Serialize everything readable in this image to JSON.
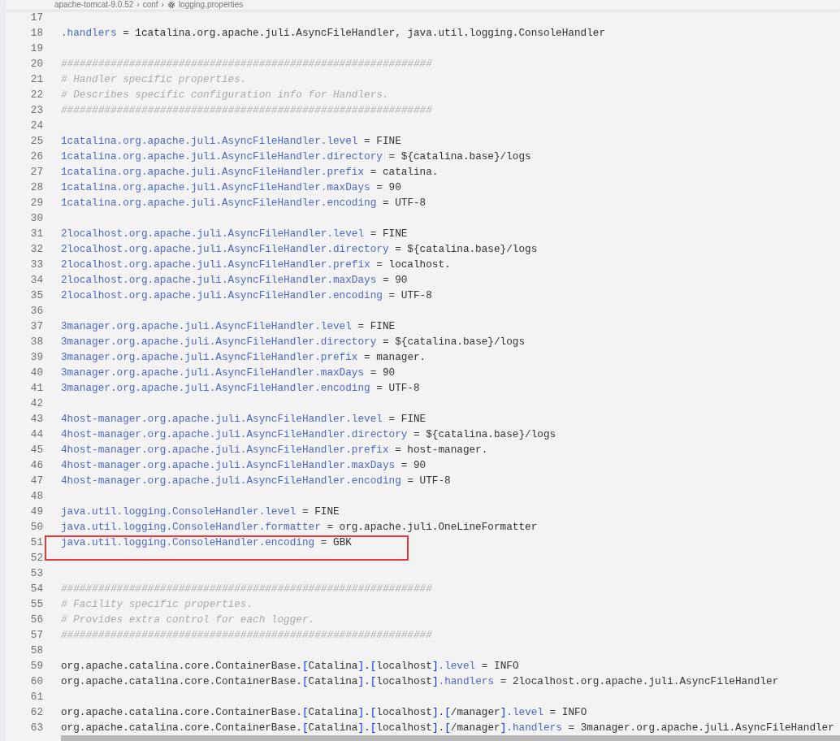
{
  "breadcrumb_separator": "›",
  "breadcrumb": [
    {
      "label": "apache-tomcat-9.0.52",
      "kind": "folder"
    },
    {
      "label": "conf",
      "kind": "folder"
    },
    {
      "label": "logging.properties",
      "kind": "file"
    }
  ],
  "lines": [
    {
      "number": "17",
      "boxed": false
    },
    {
      "number": "18",
      "boxed": false,
      "tokens": [
        {
          "kind": "key",
          "text": ".handlers"
        },
        {
          "kind": "value",
          "text": " = 1catalina.org.apache.juli.AsyncFileHandler, java.util.logging.ConsoleHandler"
        }
      ]
    },
    {
      "number": "19",
      "boxed": false
    },
    {
      "number": "20",
      "boxed": false,
      "tokens": [
        {
          "kind": "comment",
          "text": "############################################################"
        }
      ]
    },
    {
      "number": "21",
      "boxed": false,
      "tokens": [
        {
          "kind": "comment",
          "text": "# Handler specific properties."
        }
      ]
    },
    {
      "number": "22",
      "boxed": false,
      "tokens": [
        {
          "kind": "comment",
          "text": "# Describes specific configuration info for Handlers."
        }
      ]
    },
    {
      "number": "23",
      "boxed": false,
      "tokens": [
        {
          "kind": "comment",
          "text": "############################################################"
        }
      ]
    },
    {
      "number": "24",
      "boxed": false
    },
    {
      "number": "25",
      "boxed": false,
      "tokens": [
        {
          "kind": "key",
          "text": "1catalina.org.apache.juli.AsyncFileHandler.level"
        },
        {
          "kind": "value",
          "text": " = FINE"
        }
      ]
    },
    {
      "number": "26",
      "boxed": false,
      "tokens": [
        {
          "kind": "key",
          "text": "1catalina.org.apache.juli.AsyncFileHandler.directory"
        },
        {
          "kind": "value",
          "text": " = ${catalina.base}/logs"
        }
      ]
    },
    {
      "number": "27",
      "boxed": false,
      "tokens": [
        {
          "kind": "key",
          "text": "1catalina.org.apache.juli.AsyncFileHandler.prefix"
        },
        {
          "kind": "value",
          "text": " = catalina."
        }
      ]
    },
    {
      "number": "28",
      "boxed": false,
      "tokens": [
        {
          "kind": "key",
          "text": "1catalina.org.apache.juli.AsyncFileHandler.maxDays"
        },
        {
          "kind": "value",
          "text": " = 90"
        }
      ]
    },
    {
      "number": "29",
      "boxed": false,
      "tokens": [
        {
          "kind": "key",
          "text": "1catalina.org.apache.juli.AsyncFileHandler.encoding"
        },
        {
          "kind": "value",
          "text": " = UTF-8"
        }
      ]
    },
    {
      "number": "30",
      "boxed": false
    },
    {
      "number": "31",
      "boxed": false,
      "tokens": [
        {
          "kind": "key",
          "text": "2localhost.org.apache.juli.AsyncFileHandler.level"
        },
        {
          "kind": "value",
          "text": " = FINE"
        }
      ]
    },
    {
      "number": "32",
      "boxed": false,
      "tokens": [
        {
          "kind": "key",
          "text": "2localhost.org.apache.juli.AsyncFileHandler.directory"
        },
        {
          "kind": "value",
          "text": " = ${catalina.base}/logs"
        }
      ]
    },
    {
      "number": "33",
      "boxed": false,
      "tokens": [
        {
          "kind": "key",
          "text": "2localhost.org.apache.juli.AsyncFileHandler.prefix"
        },
        {
          "kind": "value",
          "text": " = localhost."
        }
      ]
    },
    {
      "number": "34",
      "boxed": false,
      "tokens": [
        {
          "kind": "key",
          "text": "2localhost.org.apache.juli.AsyncFileHandler.maxDays"
        },
        {
          "kind": "value",
          "text": " = 90"
        }
      ]
    },
    {
      "number": "35",
      "boxed": false,
      "tokens": [
        {
          "kind": "key",
          "text": "2localhost.org.apache.juli.AsyncFileHandler.encoding"
        },
        {
          "kind": "value",
          "text": " = UTF-8"
        }
      ]
    },
    {
      "number": "36",
      "boxed": false
    },
    {
      "number": "37",
      "boxed": false,
      "tokens": [
        {
          "kind": "key",
          "text": "3manager.org.apache.juli.AsyncFileHandler.level"
        },
        {
          "kind": "value",
          "text": " = FINE"
        }
      ]
    },
    {
      "number": "38",
      "boxed": false,
      "tokens": [
        {
          "kind": "key",
          "text": "3manager.org.apache.juli.AsyncFileHandler.directory"
        },
        {
          "kind": "value",
          "text": " = ${catalina.base}/logs"
        }
      ]
    },
    {
      "number": "39",
      "boxed": false,
      "tokens": [
        {
          "kind": "key",
          "text": "3manager.org.apache.juli.AsyncFileHandler.prefix"
        },
        {
          "kind": "value",
          "text": " = manager."
        }
      ]
    },
    {
      "number": "40",
      "boxed": false,
      "tokens": [
        {
          "kind": "key",
          "text": "3manager.org.apache.juli.AsyncFileHandler.maxDays"
        },
        {
          "kind": "value",
          "text": " = 90"
        }
      ]
    },
    {
      "number": "41",
      "boxed": false,
      "tokens": [
        {
          "kind": "key",
          "text": "3manager.org.apache.juli.AsyncFileHandler.encoding"
        },
        {
          "kind": "value",
          "text": " = UTF-8"
        }
      ]
    },
    {
      "number": "42",
      "boxed": false
    },
    {
      "number": "43",
      "boxed": false,
      "tokens": [
        {
          "kind": "key",
          "text": "4host-manager.org.apache.juli.AsyncFileHandler.level"
        },
        {
          "kind": "value",
          "text": " = FINE"
        }
      ]
    },
    {
      "number": "44",
      "boxed": false,
      "tokens": [
        {
          "kind": "key",
          "text": "4host-manager.org.apache.juli.AsyncFileHandler.directory"
        },
        {
          "kind": "value",
          "text": " = ${catalina.base}/logs"
        }
      ]
    },
    {
      "number": "45",
      "boxed": false,
      "tokens": [
        {
          "kind": "key",
          "text": "4host-manager.org.apache.juli.AsyncFileHandler.prefix"
        },
        {
          "kind": "value",
          "text": " = host-manager."
        }
      ]
    },
    {
      "number": "46",
      "boxed": false,
      "tokens": [
        {
          "kind": "key",
          "text": "4host-manager.org.apache.juli.AsyncFileHandler.maxDays"
        },
        {
          "kind": "value",
          "text": " = 90"
        }
      ]
    },
    {
      "number": "47",
      "boxed": false,
      "tokens": [
        {
          "kind": "key",
          "text": "4host-manager.org.apache.juli.AsyncFileHandler.encoding"
        },
        {
          "kind": "value",
          "text": " = UTF-8"
        }
      ]
    },
    {
      "number": "48",
      "boxed": false
    },
    {
      "number": "49",
      "boxed": false,
      "tokens": [
        {
          "kind": "key",
          "text": "java.util.logging.ConsoleHandler.level"
        },
        {
          "kind": "value",
          "text": " = FINE"
        }
      ]
    },
    {
      "number": "50",
      "boxed": false,
      "tokens": [
        {
          "kind": "key",
          "text": "java.util.logging.ConsoleHandler.formatter"
        },
        {
          "kind": "value",
          "text": " = org.apache.juli.OneLineFormatter"
        }
      ]
    },
    {
      "number": "51",
      "boxed": true,
      "tokens": [
        {
          "kind": "key",
          "text": "java.util.logging.ConsoleHandler.encoding"
        },
        {
          "kind": "value",
          "text": " = GBK"
        }
      ]
    },
    {
      "number": "52",
      "boxed": true
    },
    {
      "number": "53",
      "boxed": false
    },
    {
      "number": "54",
      "boxed": false,
      "tokens": [
        {
          "kind": "comment",
          "text": "############################################################"
        }
      ]
    },
    {
      "number": "55",
      "boxed": false,
      "tokens": [
        {
          "kind": "comment",
          "text": "# Facility specific properties."
        }
      ]
    },
    {
      "number": "56",
      "boxed": false,
      "tokens": [
        {
          "kind": "comment",
          "text": "# Provides extra control for each logger."
        }
      ]
    },
    {
      "number": "57",
      "boxed": false,
      "tokens": [
        {
          "kind": "comment",
          "text": "############################################################"
        }
      ]
    },
    {
      "number": "58",
      "boxed": false
    },
    {
      "number": "59",
      "boxed": false,
      "tokens": [
        {
          "kind": "value",
          "text": "org.apache.catalina.core.ContainerBase."
        },
        {
          "kind": "bracket",
          "text": "["
        },
        {
          "kind": "value",
          "text": "Catalina"
        },
        {
          "kind": "bracket",
          "text": "]"
        },
        {
          "kind": "value",
          "text": "."
        },
        {
          "kind": "bracket",
          "text": "["
        },
        {
          "kind": "value",
          "text": "localhost"
        },
        {
          "kind": "bracket",
          "text": "]"
        },
        {
          "kind": "key",
          "text": ".level"
        },
        {
          "kind": "value",
          "text": " = INFO"
        }
      ]
    },
    {
      "number": "60",
      "boxed": false,
      "tokens": [
        {
          "kind": "value",
          "text": "org.apache.catalina.core.ContainerBase."
        },
        {
          "kind": "bracket",
          "text": "["
        },
        {
          "kind": "value",
          "text": "Catalina"
        },
        {
          "kind": "bracket",
          "text": "]"
        },
        {
          "kind": "value",
          "text": "."
        },
        {
          "kind": "bracket",
          "text": "["
        },
        {
          "kind": "value",
          "text": "localhost"
        },
        {
          "kind": "bracket",
          "text": "]"
        },
        {
          "kind": "key",
          "text": ".handlers"
        },
        {
          "kind": "value",
          "text": " = 2localhost.org.apache.juli.AsyncFileHandler"
        }
      ]
    },
    {
      "number": "61",
      "boxed": false
    },
    {
      "number": "62",
      "boxed": false,
      "tokens": [
        {
          "kind": "value",
          "text": "org.apache.catalina.core.ContainerBase."
        },
        {
          "kind": "bracket",
          "text": "["
        },
        {
          "kind": "value",
          "text": "Catalina"
        },
        {
          "kind": "bracket",
          "text": "]"
        },
        {
          "kind": "value",
          "text": "."
        },
        {
          "kind": "bracket",
          "text": "["
        },
        {
          "kind": "value",
          "text": "localhost"
        },
        {
          "kind": "bracket",
          "text": "]"
        },
        {
          "kind": "value",
          "text": "."
        },
        {
          "kind": "bracket",
          "text": "["
        },
        {
          "kind": "value",
          "text": "/manager"
        },
        {
          "kind": "bracket",
          "text": "]"
        },
        {
          "kind": "key",
          "text": ".level"
        },
        {
          "kind": "value",
          "text": " = INFO"
        }
      ]
    },
    {
      "number": "63",
      "boxed": false,
      "tokens": [
        {
          "kind": "value",
          "text": "org.apache.catalina.core.ContainerBase."
        },
        {
          "kind": "bracket",
          "text": "["
        },
        {
          "kind": "value",
          "text": "Catalina"
        },
        {
          "kind": "bracket",
          "text": "]"
        },
        {
          "kind": "value",
          "text": "."
        },
        {
          "kind": "bracket",
          "text": "["
        },
        {
          "kind": "value",
          "text": "localhost"
        },
        {
          "kind": "bracket",
          "text": "]"
        },
        {
          "kind": "value",
          "text": "."
        },
        {
          "kind": "bracket",
          "text": "["
        },
        {
          "kind": "value",
          "text": "/manager"
        },
        {
          "kind": "bracket",
          "text": "]"
        },
        {
          "kind": "key",
          "text": ".handlers"
        },
        {
          "kind": "value",
          "text": " = 3manager.org.apache.juli.AsyncFileHandler"
        }
      ]
    }
  ]
}
